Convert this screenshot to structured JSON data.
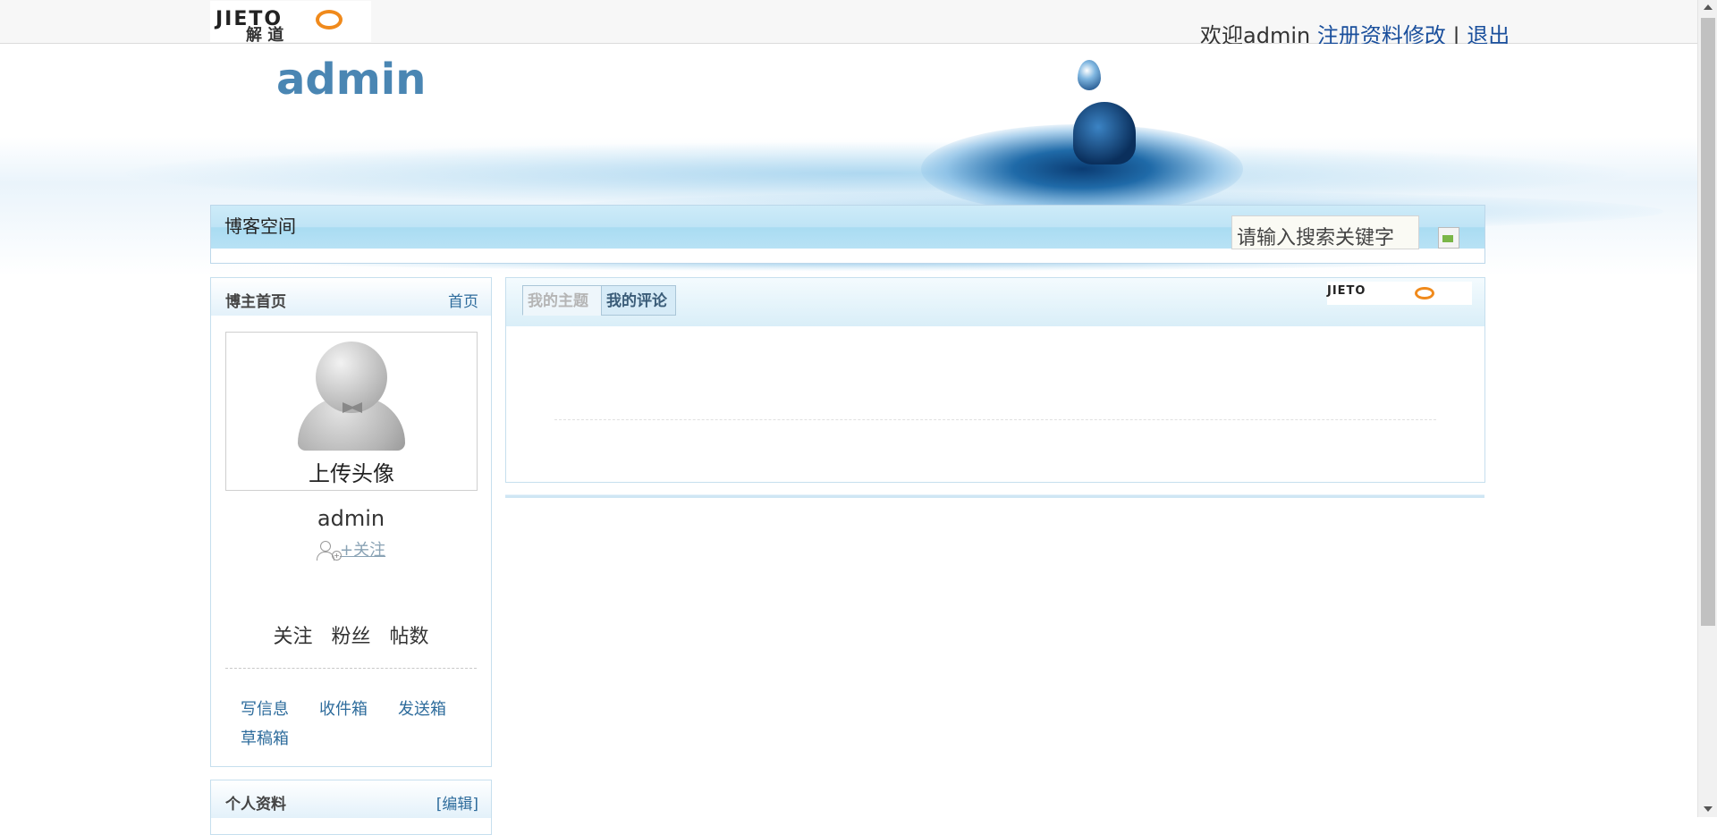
{
  "header": {
    "logo_top": "JIETO",
    "logo_bottom": "解 道",
    "welcome_text": "欢迎admin",
    "profile_link": "注册资料修改",
    "separator": "|",
    "logout_link": "退出"
  },
  "banner": {
    "blog_title": "admin"
  },
  "nav": {
    "title": "博客空间",
    "search_placeholder": "请输入搜索关键字"
  },
  "sidebar": {
    "home_panel": {
      "title": "博主首页",
      "link": "首页"
    },
    "avatar_label": "上传头像",
    "user_name": "admin",
    "follow_link": "+关注",
    "stats": [
      "关注",
      "粉丝",
      "帖数"
    ],
    "mail_links": [
      "写信息",
      "收件箱",
      "发送箱",
      "草稿箱"
    ],
    "profile_panel": {
      "title": "个人资料",
      "link": "[编辑]"
    }
  },
  "main": {
    "tabs": [
      {
        "label": "我的主题"
      },
      {
        "label": "我的评论"
      }
    ],
    "logo_small": "JIETO"
  }
}
